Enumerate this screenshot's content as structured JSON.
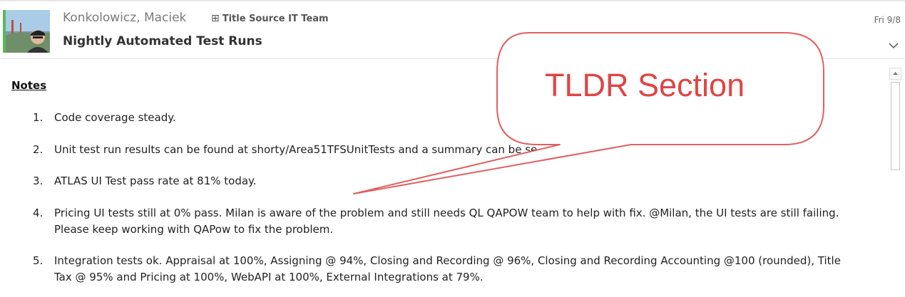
{
  "header": {
    "sender": "Konkolowicz, Maciek",
    "group": "Title Source IT Team",
    "subject": "Nightly Automated Test Runs",
    "date": "Fri 9/8",
    "presence_color": "#5cb85c"
  },
  "body": {
    "notes_heading": "Notes",
    "items": [
      {
        "num": "1.",
        "text": "Code coverage steady."
      },
      {
        "num": "2.",
        "text": "Unit test run results can be found at shorty/Area51TFSUnitTests and a summary can be se"
      },
      {
        "num": "3.",
        "text": "ATLAS UI Test pass rate at 81% today."
      },
      {
        "num": "4.",
        "text": "Pricing UI tests still at 0% pass. Milan is aware of the problem and still needs QL QAPOW team to help with fix. @Milan, the UI tests are still failing. Please keep working with QAPow to fix the problem."
      },
      {
        "num": "5.",
        "text": "Integration tests ok. Appraisal at 100%, Assigning @ 94%, Closing and Recording @ 96%, Closing and Recording Accounting @100 (rounded), Title Tax @ 95% and Pricing at 100%, WebAPI at 100%, External Integrations at 79%."
      }
    ]
  },
  "callout": {
    "text": "TLDR Section",
    "color": "#e04545"
  }
}
